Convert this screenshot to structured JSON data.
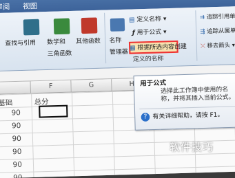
{
  "tabs": {
    "review": "审阅",
    "view": "视图"
  },
  "ribbon": {
    "lookup": {
      "line1": "查找与引用",
      "line2": "三角函数"
    },
    "math": {
      "line1": "数学和",
      "line2": "三角函数"
    },
    "other": {
      "label": "其他函数"
    },
    "name_manager": {
      "line1": "名称",
      "line2": "管理器"
    },
    "define_name": "定义名称",
    "use_in_formula": "用于公式",
    "create_from_selection": "根据所选内容创建",
    "group_label": "定义的名称",
    "trace_precedents": "追踪引用单",
    "trace_dependents": "追踪从属单",
    "remove_arrows": "移去箭头"
  },
  "tooltip": {
    "title": "用于公式",
    "body": "选择此工作簿中使用的名称，并将其插入当前公式。",
    "help": "有关详细帮助，请按 F1。"
  },
  "columns": [
    "F",
    "G",
    "H",
    "I"
  ],
  "cells": {
    "basic": "基础",
    "total": "总分"
  },
  "rows": [
    "90",
    "90",
    "90",
    "90",
    "90",
    "90"
  ],
  "watermark": "软件技巧"
}
